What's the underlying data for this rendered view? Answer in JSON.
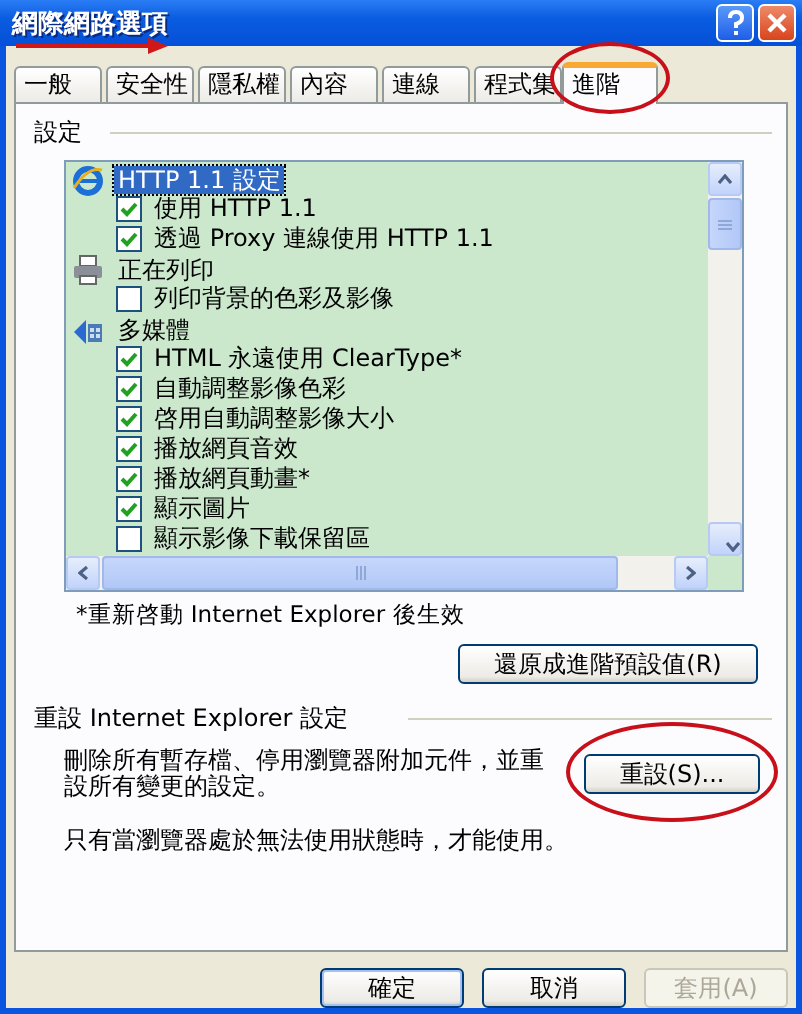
{
  "window": {
    "title": "網際網路選項",
    "title_marked": true
  },
  "tabs": [
    {
      "label": "一般",
      "selected": false,
      "highlighted": false
    },
    {
      "label": "安全性",
      "selected": false,
      "highlighted": false
    },
    {
      "label": "隱私權",
      "selected": false,
      "highlighted": false
    },
    {
      "label": "內容",
      "selected": false,
      "highlighted": false
    },
    {
      "label": "連線",
      "selected": false,
      "highlighted": false
    },
    {
      "label": "程式集",
      "selected": false,
      "highlighted": false
    },
    {
      "label": "進階",
      "selected": true,
      "highlighted": true
    }
  ],
  "settings": {
    "label": "設定",
    "items": [
      {
        "kind": "category",
        "label": "HTTP 1.1 設定",
        "selected": true
      },
      {
        "kind": "checkbox",
        "label": "使用 HTTP 1.1",
        "checked": true
      },
      {
        "kind": "checkbox",
        "label": "透過 Proxy 連線使用 HTTP 1.1",
        "checked": true
      },
      {
        "kind": "category",
        "label": "正在列印",
        "selected": false
      },
      {
        "kind": "checkbox",
        "label": "列印背景的色彩及影像",
        "checked": false
      },
      {
        "kind": "category",
        "label": "多媒體",
        "selected": false
      },
      {
        "kind": "checkbox",
        "label": "HTML 永遠使用 ClearType*",
        "checked": true
      },
      {
        "kind": "checkbox",
        "label": "自動調整影像色彩",
        "checked": true
      },
      {
        "kind": "checkbox",
        "label": "啓用自動調整影像大小",
        "checked": true
      },
      {
        "kind": "checkbox",
        "label": "播放網頁音效",
        "checked": true
      },
      {
        "kind": "checkbox",
        "label": "播放網頁動畫*",
        "checked": true
      },
      {
        "kind": "checkbox",
        "label": "顯示圖片",
        "checked": true
      },
      {
        "kind": "checkbox",
        "label": "顯示影像下載保留區",
        "checked": false
      }
    ],
    "note": "*重新啓動 Internet Explorer 後生效",
    "restore_button": "還原成進階預設值(R)"
  },
  "reset": {
    "label": "重設 Internet Explorer 設定",
    "description": "刪除所有暫存檔、停用瀏覽器附加元件，並重設所有變更的設定。",
    "button": {
      "label": "重設(S)...",
      "highlighted": true
    },
    "hint": "只有當瀏覽器處於無法使用狀態時，才能使用。"
  },
  "buttons": [
    {
      "label": "確定",
      "disabled": false,
      "default": true
    },
    {
      "label": "取消",
      "disabled": false,
      "default": false
    },
    {
      "label": "套用(A)",
      "disabled": true,
      "default": false
    }
  ]
}
